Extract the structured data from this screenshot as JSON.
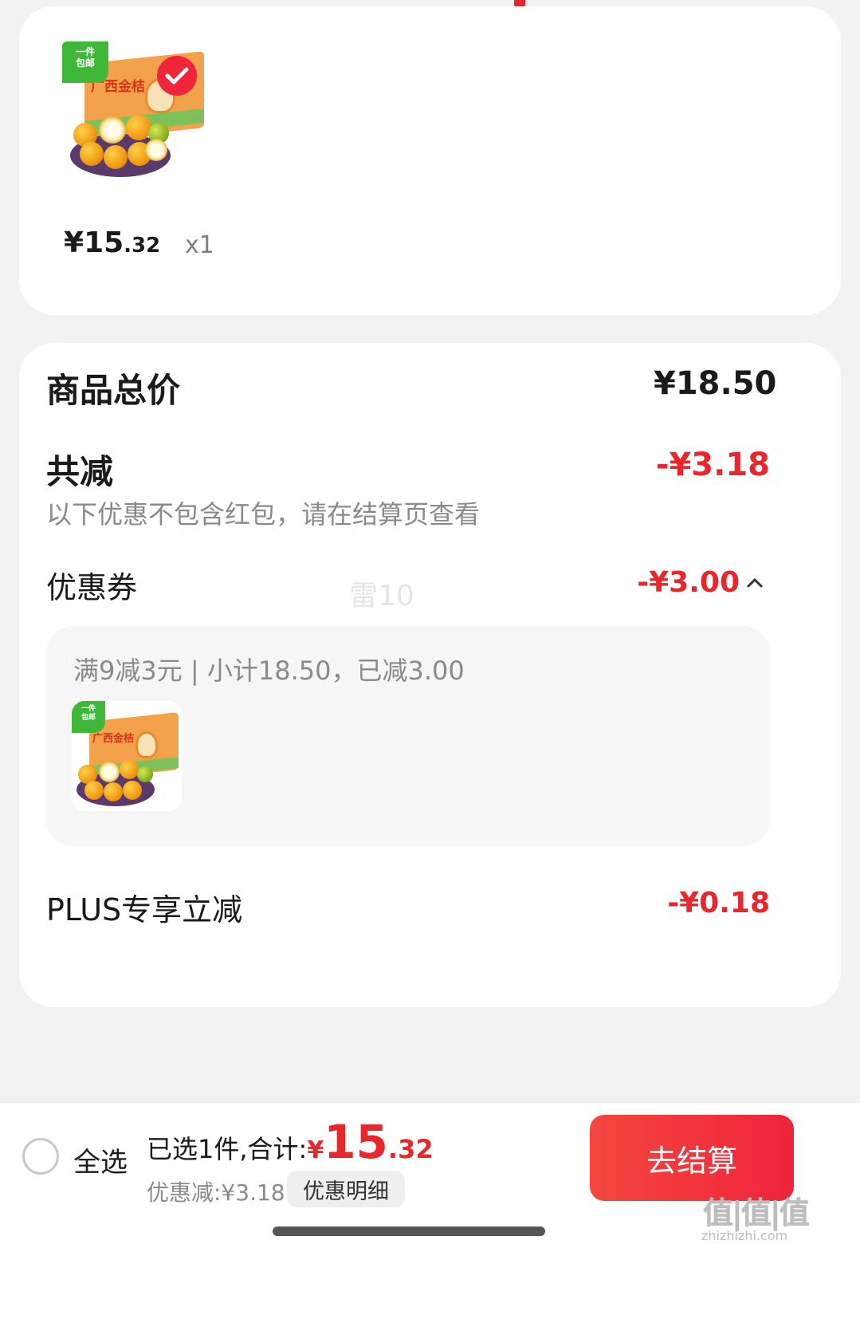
{
  "product": {
    "thumb_tag": "一件\n包邮",
    "box_brand": "广西金桔",
    "price_symbol": "¥",
    "price_int": "15",
    "price_dec": ".32",
    "quantity": "x1",
    "selected": true
  },
  "summary": {
    "total_label": "商品总价",
    "total_value": "¥18.50",
    "discount_label": "共减",
    "discount_value": "-¥3.18",
    "discount_note": "以下优惠不包含红包，请在结算页查看",
    "coupon_label": "优惠券",
    "coupon_value": "-¥3.00",
    "coupon_expanded": true,
    "center_watermark": "雷10",
    "coupon_rule": "满9减3元 | 小计18.50，已减3.00",
    "plus_label": "PLUS专享立减",
    "plus_value": "-¥0.18"
  },
  "bottom_bar": {
    "select_all_label": "全选",
    "selected_text": "已选1件,合计:",
    "total_symbol": "¥",
    "total_int": "15",
    "total_dec": ".32",
    "saved_text": "优惠减:¥3.18",
    "detail_button": "优惠明细",
    "checkout_button": "去结算"
  },
  "watermark": {
    "text": "值|值|值",
    "url": "zhizhizhi.com"
  },
  "colors": {
    "accent_red": "#e8262c",
    "checkout_gradient_start": "#f4473e",
    "checkout_gradient_end": "#f0233b",
    "page_background": "#f2f2f2"
  }
}
